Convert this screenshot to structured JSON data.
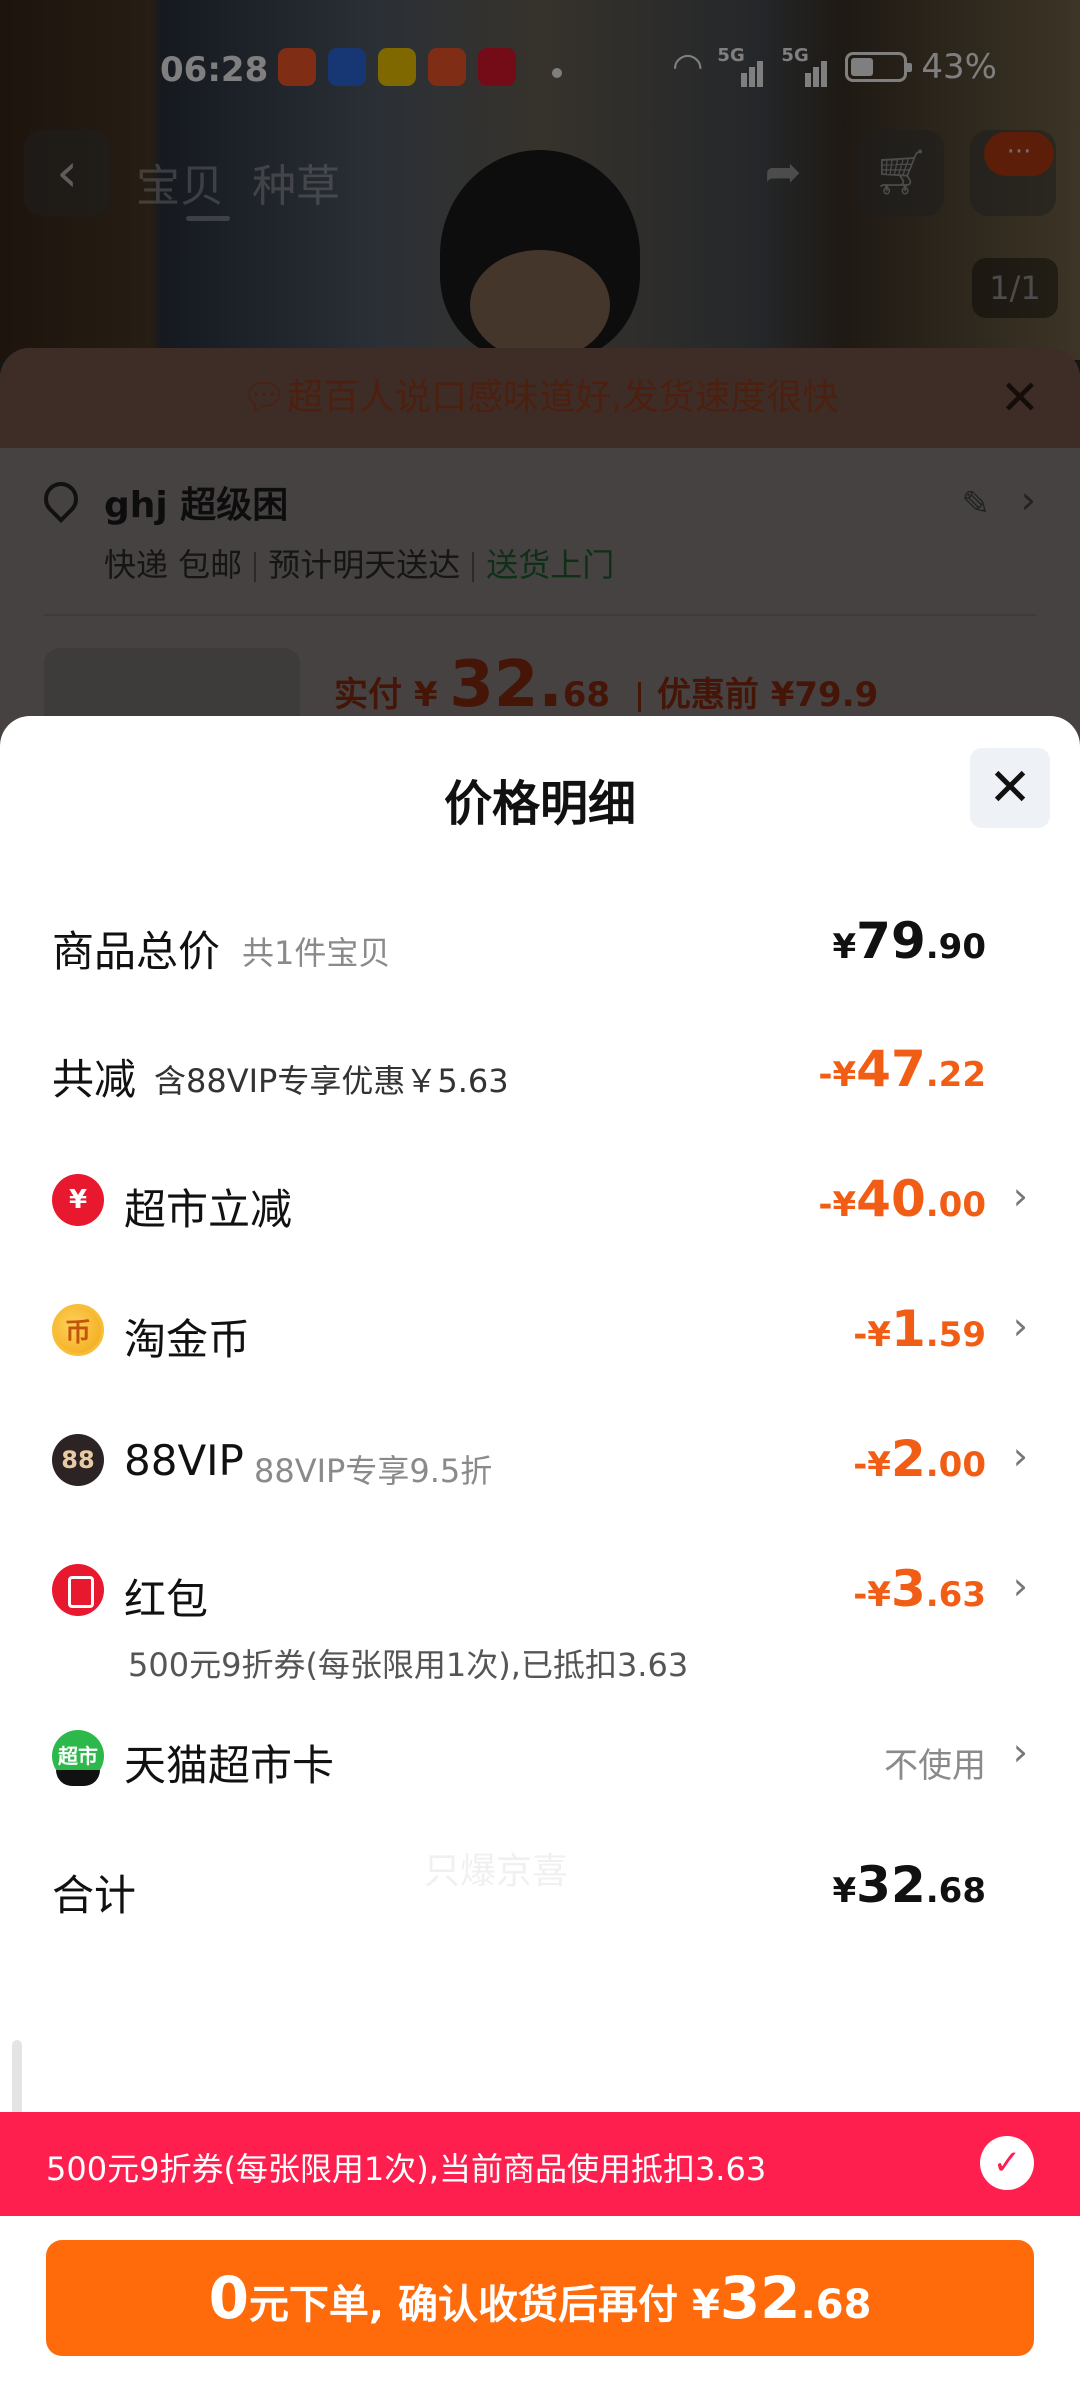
{
  "status_bar": {
    "time": "06:28",
    "signal1": "5G",
    "signal2": "5G",
    "battery": "43%"
  },
  "nav": {
    "tabs": [
      "宝贝",
      "种草"
    ],
    "counter": "1/1",
    "badge": "···"
  },
  "background_panel": {
    "banner": "超百人说口感味道好,发货速度很快",
    "address_name": "ghj 超级困",
    "ship_1": "快递 包邮",
    "ship_2": "预计明天送达",
    "ship_3": "送货上门",
    "pay_label": "实付 ¥ ",
    "pay_int": "32.",
    "pay_dec": "68",
    "before_label": "优惠前 ¥79.9"
  },
  "sheet": {
    "title": "价格明细",
    "rows": {
      "total": {
        "label": "商品总价",
        "sub": "共1件宝贝",
        "sym": "¥",
        "int": "79",
        "dec": ".90"
      },
      "reduce": {
        "label": "共减",
        "sub": "含88VIP专享优惠￥5.63",
        "sym": "-¥",
        "int": "47",
        "dec": ".22"
      },
      "supermarket": {
        "label": "超市立减",
        "sym": "-¥",
        "int": "40",
        "dec": ".00",
        "icon_glyph": "¥"
      },
      "coin": {
        "label": "淘金币",
        "sym": "-¥",
        "int": "1",
        "dec": ".59",
        "icon_glyph": "币"
      },
      "vip": {
        "label": "88VIP",
        "sub": "88VIP专享9.5折",
        "sym": "-¥",
        "int": "2",
        "dec": ".00",
        "icon_glyph": "88"
      },
      "redpacket": {
        "label": "红包",
        "desc": "500元9折券(每张限用1次),已抵扣3.63",
        "sym": "-¥",
        "int": "3",
        "dec": ".63"
      },
      "card": {
        "label": "天猫超市卡",
        "status": "不使用",
        "icon_glyph": "超市"
      },
      "sum": {
        "label": "合计",
        "sym": "¥",
        "int": "32",
        "dec": ".68"
      }
    },
    "watermark": "只爆京喜"
  },
  "coupon_bar": {
    "text": "500元9折券(每张限用1次),当前商品使用抵扣3.63",
    "check": "✓"
  },
  "cta": {
    "zero": "0",
    "text": "元下单, 确认收货后再付 ¥",
    "int": "32",
    "dec": ".68"
  },
  "colors": {
    "orange": "#f25d16",
    "cta": "#ff6a0b",
    "coupon_red": "#ff1f4f"
  }
}
